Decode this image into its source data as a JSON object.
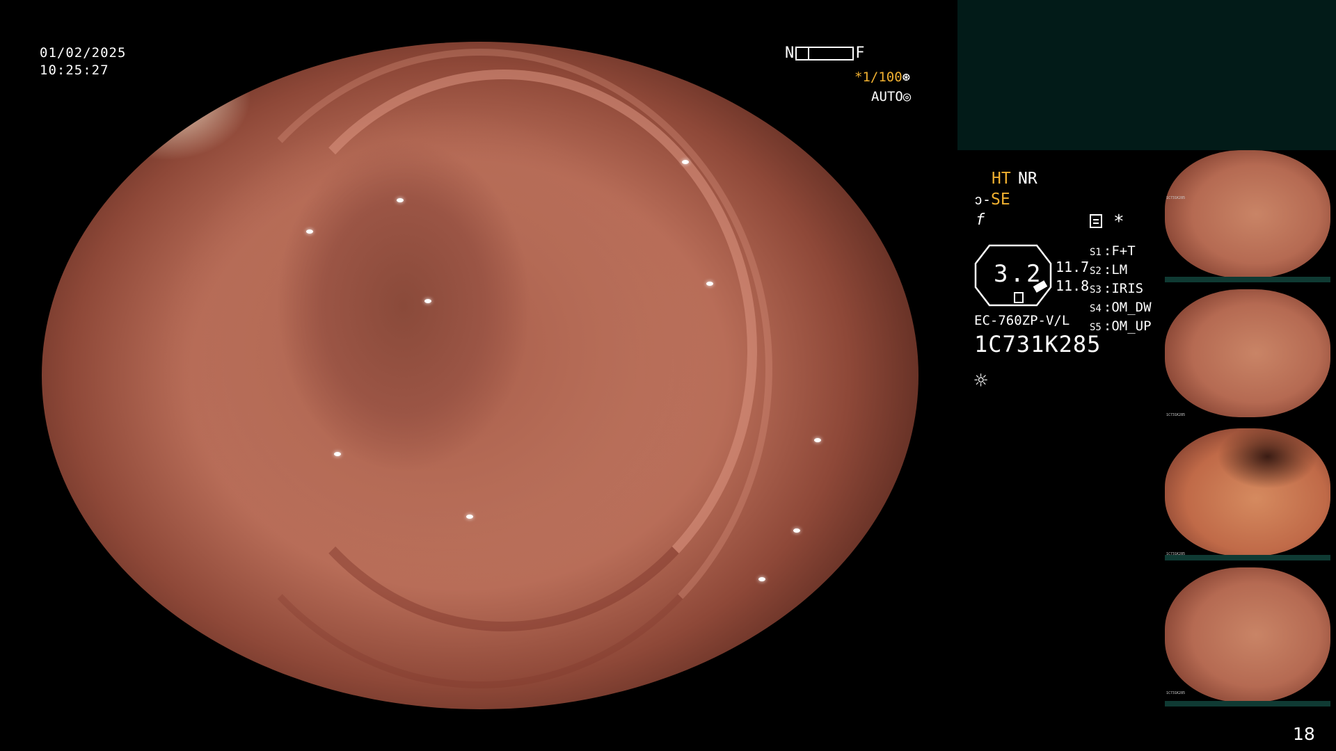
{
  "overlay": {
    "date": "01/02/2025",
    "time": "10:25:27",
    "near_label": "N",
    "far_label": "F",
    "shutter": "*1/100",
    "iris_mode": "AUTO"
  },
  "panel": {
    "mode_ht": "HT",
    "mode_nr": "NR",
    "mode_se": "SE",
    "f_symbol": "f",
    "star": "*",
    "octagon_value": "3.2",
    "value_a": "11.7",
    "value_b": "11.8",
    "model": "EC-760ZP-V/L",
    "serial": "1C731K285",
    "switches": [
      {
        "label": "S1",
        "value": "F+T"
      },
      {
        "label": "S2",
        "value": "LM"
      },
      {
        "label": "S3",
        "value": "IRIS"
      },
      {
        "label": "S4",
        "value": "OM_DW"
      },
      {
        "label": "S5",
        "value": "OM_UP"
      }
    ]
  },
  "thumbnail_serial": "1C731K285",
  "page_number": "18",
  "colors": {
    "accent_orange": "#f0b030",
    "panel_teal": "#021b18",
    "tissue": "#b46a55"
  },
  "icons": [
    "shutter-icon",
    "iris-icon",
    "se-icon",
    "document-icon",
    "light-icon"
  ]
}
